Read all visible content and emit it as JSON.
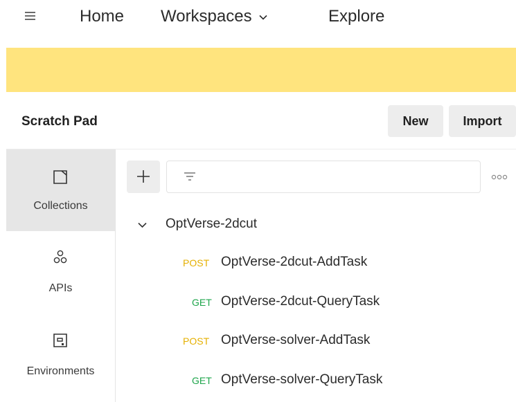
{
  "topnav": {
    "menu_icon": "hamburger-icon",
    "home": "Home",
    "workspaces": "Workspaces",
    "explore": "Explore"
  },
  "banner": {
    "color": "#ffe47e"
  },
  "header": {
    "title": "Scratch Pad",
    "new_label": "New",
    "import_label": "Import"
  },
  "sidebar": {
    "items": [
      {
        "label": "Collections",
        "icon": "collection-icon",
        "active": true
      },
      {
        "label": "APIs",
        "icon": "apis-icon"
      },
      {
        "label": "Environments",
        "icon": "environment-icon"
      }
    ]
  },
  "toolbar": {
    "add_icon": "plus-icon",
    "filter_icon": "filter-icon",
    "more_icon": "more-horizontal-icon"
  },
  "collection": {
    "name": "OptVerse-2dcut",
    "expanded": true,
    "requests": [
      {
        "method": "POST",
        "name": "OptVerse-2dcut-AddTask"
      },
      {
        "method": "GET",
        "name": "OptVerse-2dcut-QueryTask"
      },
      {
        "method": "POST",
        "name": "OptVerse-solver-AddTask"
      },
      {
        "method": "GET",
        "name": "OptVerse-solver-QueryTask"
      }
    ]
  },
  "colors": {
    "post": "#e5b000",
    "get": "#1ea54b"
  }
}
